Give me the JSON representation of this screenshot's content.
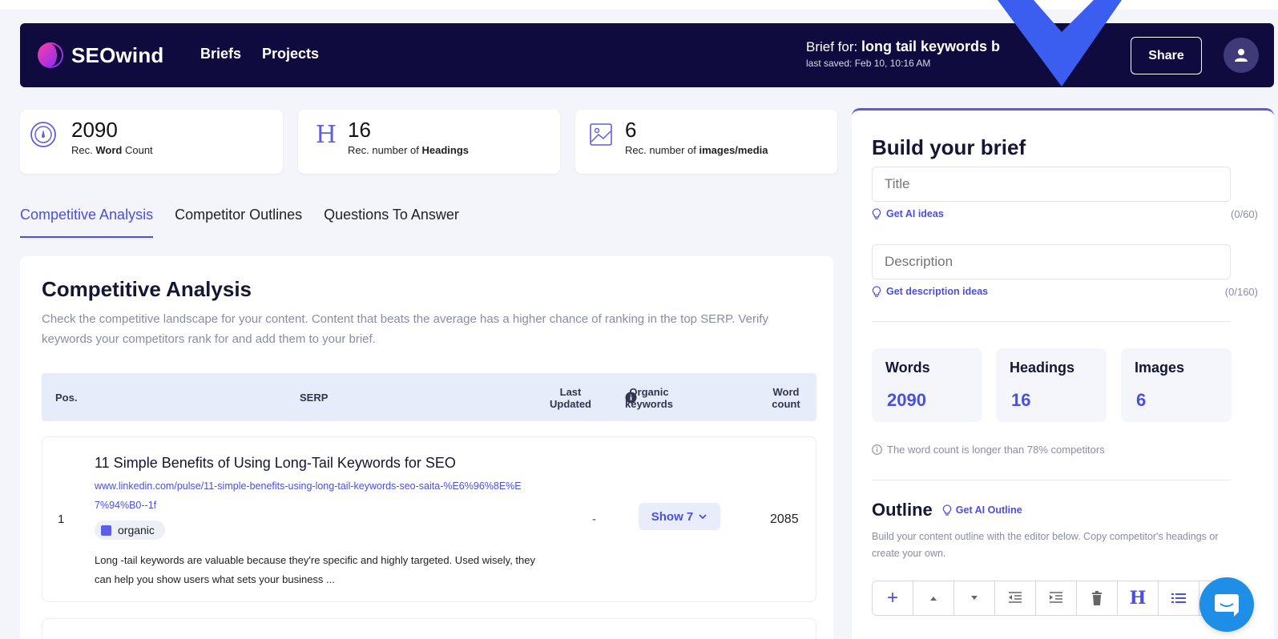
{
  "header": {
    "logo_text": "SEOwind",
    "nav": [
      "Briefs",
      "Projects"
    ],
    "brief_for_label": "Brief for:",
    "brief_keyword": "long tail keywords b",
    "last_saved": "last saved: Feb 10, 10:16 AM",
    "share_label": "Share"
  },
  "stats": [
    {
      "value": "2090",
      "label_prefix": "Rec.",
      "label_bold": "Word",
      "label_suffix": "Count",
      "icon": "gauge-icon"
    },
    {
      "value": "16",
      "label_prefix": "Rec. number of",
      "label_bold": "Headings",
      "label_suffix": "",
      "icon": "heading-icon"
    },
    {
      "value": "6",
      "label_prefix": "Rec. number of",
      "label_bold": "images/media",
      "label_suffix": "",
      "icon": "image-icon"
    }
  ],
  "tabs": [
    "Competitive Analysis",
    "Competitor Outlines",
    "Questions To Answer"
  ],
  "active_tab": "Competitive Analysis",
  "competitive": {
    "title": "Competitive Analysis",
    "description": "Check the competitive landscape for your content. Content that beats the average has a higher chance of ranking in the top SERP. Verify keywords your competitors rank for and add them to your brief.",
    "columns": {
      "pos": "Pos.",
      "serp": "SERP",
      "last_updated": "Last Updated",
      "organic_keywords": "Organic keywords",
      "word_count": "Word count"
    },
    "rows": [
      {
        "pos": "1",
        "title": "11 Simple Benefits of Using Long-Tail Keywords for SEO",
        "url": "www.linkedin.com/pulse/11-simple-benefits-using-long-tail-keywords-seo-saita-%E6%96%8E%E7%94%B0--1f",
        "badge": "organic",
        "snippet": "Long -tail keywords are valuable because they're specific and highly targeted. Used wisely, they can help you show users what sets your business ...",
        "last_updated": "-",
        "show_label": "Show 7",
        "word_count": "2085"
      }
    ]
  },
  "brief": {
    "title": "Build your brief",
    "title_placeholder": "Title",
    "title_hint": "Get AI ideas",
    "title_count": "(0/60)",
    "description_placeholder": "Description",
    "description_hint": "Get description ideas",
    "description_count": "(0/160)",
    "metrics": [
      {
        "label": "Words",
        "value": "2090"
      },
      {
        "label": "Headings",
        "value": "16"
      },
      {
        "label": "Images",
        "value": "6"
      }
    ],
    "note": "The word count is longer than 78% competitors",
    "outline_title": "Outline",
    "outline_ai": "Get AI Outline",
    "outline_desc": "Build your content outline with the editor below. Copy competitor's headings or create your own."
  },
  "colors": {
    "header_bg": "#0f0b3e",
    "accent": "#4b4fe0",
    "chat": "#1f8ee6"
  }
}
